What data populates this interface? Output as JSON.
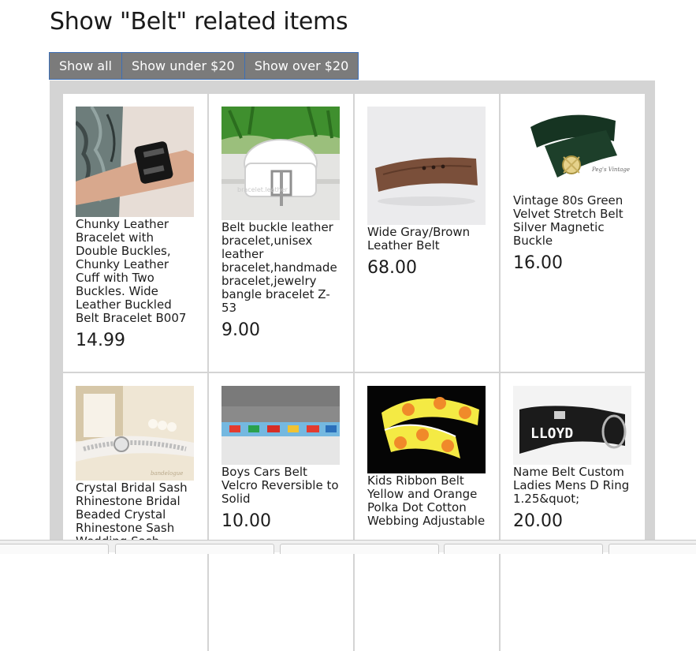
{
  "page": {
    "title": "Show \"Belt\" related items"
  },
  "filters": [
    {
      "label": "Show all"
    },
    {
      "label": "Show under $20"
    },
    {
      "label": "Show over $20"
    }
  ],
  "items": [
    {
      "title": "Chunky Leather Bracelet with Double Buckles, Chunky Leather Cuff with Two Buckles. Wide Leather Buckled Belt Bracelet B007",
      "price": "14.99"
    },
    {
      "title": "Belt buckle leather bracelet,unisex leather bracelet,handmade bracelet,jewelry bangle bracelet Z-53",
      "price": "9.00"
    },
    {
      "title": "Wide Gray/Brown Leather Belt",
      "price": "68.00"
    },
    {
      "title": "Vintage 80s Green Velvet Stretch Belt Silver Magnetic Buckle",
      "price": "16.00"
    },
    {
      "title": "Crystal Bridal Sash Rhinestone Bridal Beaded Crystal Rhinestone Sash Wedding Sash",
      "price": ""
    },
    {
      "title": "Boys Cars Belt Velcro Reversible to Solid",
      "price": "10.00"
    },
    {
      "title": "Kids Ribbon Belt Yellow and Orange Polka Dot Cotton Webbing Adjustable",
      "price": ""
    },
    {
      "title": "Name Belt Custom Ladies Mens D Ring 1.25&quot;",
      "price": "20.00"
    }
  ],
  "thumbs": {
    "item2_watermark": "bracelet.leather",
    "item4_brand": "Peg's Vintage",
    "item5_watermark": "bandelogue",
    "item8_name": "LLOYD"
  }
}
